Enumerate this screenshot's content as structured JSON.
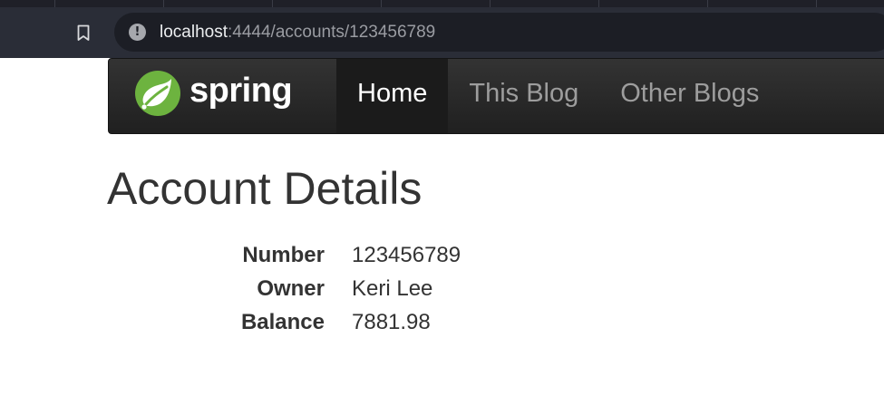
{
  "browser": {
    "url_host": "localhost",
    "url_path": ":4444/accounts/123456789",
    "info_glyph": "!",
    "bookmark_icon": "bookmark-icon"
  },
  "navbar": {
    "brand": "spring",
    "brand_color": "#6db33f",
    "items": [
      {
        "label": "Home",
        "active": true
      },
      {
        "label": "This Blog",
        "active": false
      },
      {
        "label": "Other Blogs",
        "active": false
      }
    ]
  },
  "page": {
    "title": "Account Details",
    "fields": [
      {
        "label": "Number",
        "value": "123456789"
      },
      {
        "label": "Owner",
        "value": "Keri Lee"
      },
      {
        "label": "Balance",
        "value": "7881.98"
      }
    ]
  }
}
